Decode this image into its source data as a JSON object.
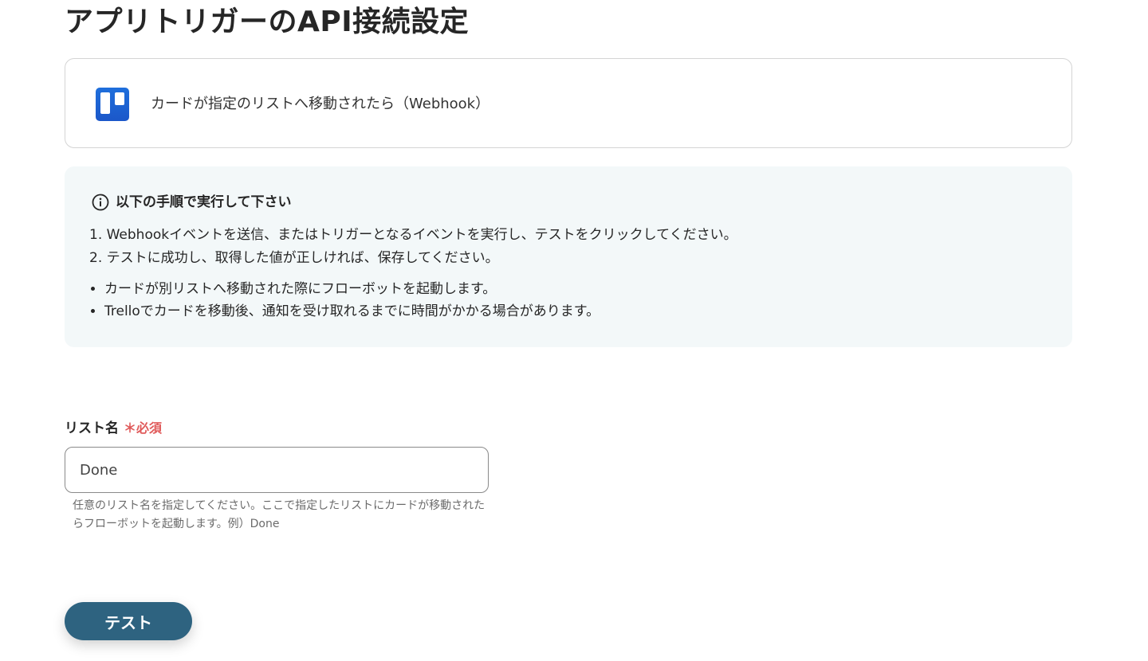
{
  "page": {
    "title": "アプリトリガーのAPI接続設定"
  },
  "trigger": {
    "app_icon": "trello-logo",
    "label": "カードが指定のリストへ移動されたら（Webhook）"
  },
  "instructions": {
    "icon": "info-icon",
    "heading": "以下の手順で実行して下さい",
    "steps": [
      "1. Webhookイベントを送信、またはトリガーとなるイベントを実行し、テストをクリックしてください。",
      "2. テストに成功し、取得した値が正しければ、保存してください。"
    ],
    "notes": [
      "カードが別リストへ移動された際にフローボットを起動します。",
      "Trelloでカードを移動後、通知を受け取れるまでに時間がかかる場合があります。"
    ]
  },
  "list_name_field": {
    "label": "リスト名",
    "required_label": "＊必須",
    "value": "Done",
    "help": "任意のリスト名を指定してください。ここで指定したリストにカードが移動されたらフローボットを起動します。例）Done"
  },
  "actions": {
    "test_label": "テスト"
  },
  "colors": {
    "accent": "#2e6380",
    "required": "#e05a5a",
    "info_bg": "#f3f8f9",
    "trello_blue": "#1f6fdc"
  }
}
